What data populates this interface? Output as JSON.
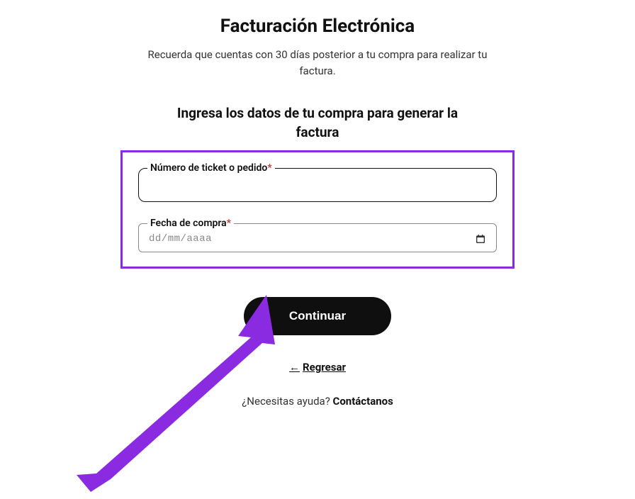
{
  "header": {
    "title": "Facturación Electrónica",
    "subtitle": "Recuerda que cuentas con 30 días posterior a tu compra para realizar tu factura."
  },
  "form": {
    "heading": "Ingresa los datos de tu compra para generar la factura",
    "ticket": {
      "label": "Número de ticket o pedido",
      "required_mark": "*",
      "value": ""
    },
    "date": {
      "label": "Fecha de compra",
      "required_mark": "*",
      "placeholder": "dd/mm/aaaa"
    },
    "continue_label": "Continuar",
    "back_label": "Regresar"
  },
  "help": {
    "prompt": "¿Necesitas ayuda? ",
    "contact_label": "Contáctanos"
  },
  "colors": {
    "highlight": "#8a2be2",
    "button_bg": "#0f0f0f",
    "required": "#d32f2f"
  }
}
